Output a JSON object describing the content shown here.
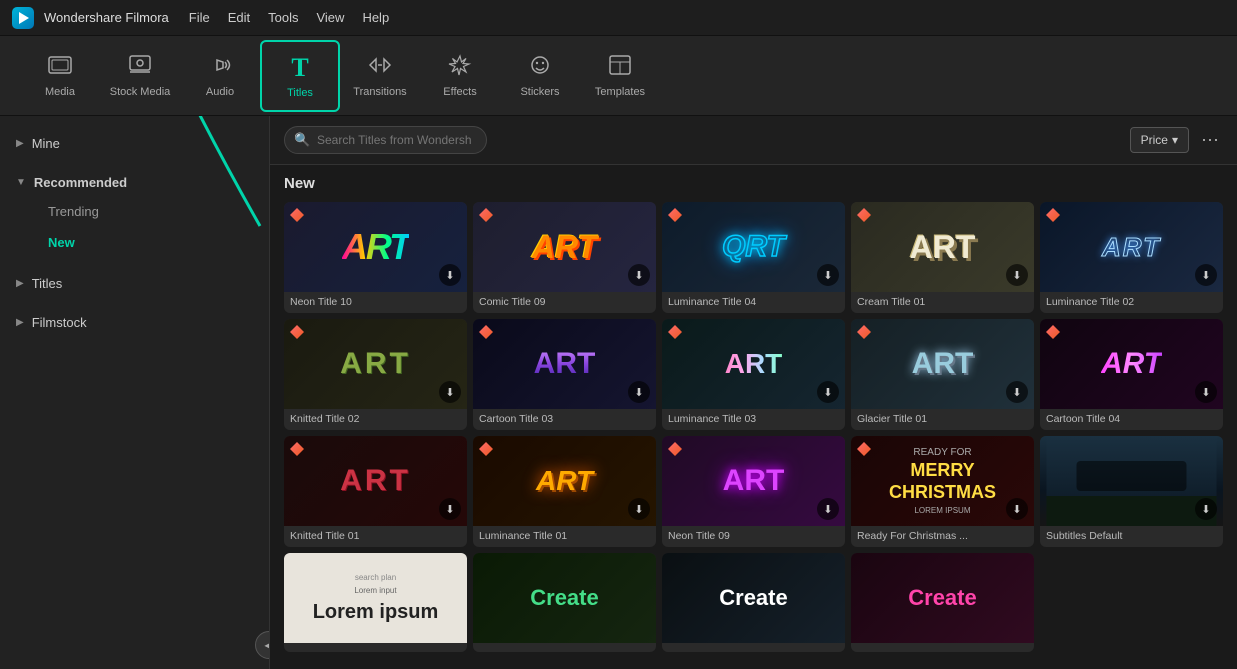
{
  "app": {
    "name": "Wondershare Filmora",
    "menus": [
      "File",
      "Edit",
      "Tools",
      "View",
      "Help"
    ]
  },
  "toolbar": {
    "items": [
      {
        "id": "media",
        "label": "Media",
        "icon": "🎬"
      },
      {
        "id": "stock-media",
        "label": "Stock Media",
        "icon": "📽"
      },
      {
        "id": "audio",
        "label": "Audio",
        "icon": "🎵"
      },
      {
        "id": "titles",
        "label": "Titles",
        "icon": "T",
        "active": true
      },
      {
        "id": "transitions",
        "label": "Transitions",
        "icon": "↔"
      },
      {
        "id": "effects",
        "label": "Effects",
        "icon": "✦"
      },
      {
        "id": "stickers",
        "label": "Stickers",
        "icon": "✿"
      },
      {
        "id": "templates",
        "label": "Templates",
        "icon": "▦"
      }
    ]
  },
  "sidebar": {
    "mine_label": "Mine",
    "recommended_label": "Recommended",
    "trending_label": "Trending",
    "new_label": "New",
    "titles_label": "Titles",
    "filmstock_label": "Filmstock"
  },
  "search": {
    "placeholder": "Search Titles from Wondershare Filmstock"
  },
  "price_button": "Price",
  "section": {
    "new_label": "New"
  },
  "tiles": [
    {
      "id": "neon-10",
      "label": "Neon Title 10"
    },
    {
      "id": "comic-09",
      "label": "Comic Title 09"
    },
    {
      "id": "luminance-04",
      "label": "Luminance Title 04"
    },
    {
      "id": "cream-01",
      "label": "Cream Title 01"
    },
    {
      "id": "luminance-02",
      "label": "Luminance Title 02"
    },
    {
      "id": "knitted-02",
      "label": "Knitted Title 02"
    },
    {
      "id": "cartoon-03",
      "label": "Cartoon Title 03"
    },
    {
      "id": "luminance-03",
      "label": "Luminance Title 03"
    },
    {
      "id": "glacier-01",
      "label": "Glacier Title 01"
    },
    {
      "id": "cartoon-04",
      "label": "Cartoon Title 04"
    },
    {
      "id": "knitted-01",
      "label": "Knitted Title 01"
    },
    {
      "id": "luminance-01",
      "label": "Luminance Title 01"
    },
    {
      "id": "neon-09",
      "label": "Neon Title 09"
    },
    {
      "id": "christmas",
      "label": "Ready For Christmas ..."
    },
    {
      "id": "subtitles",
      "label": "Subtitles Default"
    },
    {
      "id": "lorem",
      "label": ""
    },
    {
      "id": "green-create",
      "label": ""
    },
    {
      "id": "dark-create",
      "label": ""
    },
    {
      "id": "pink-create",
      "label": ""
    }
  ]
}
